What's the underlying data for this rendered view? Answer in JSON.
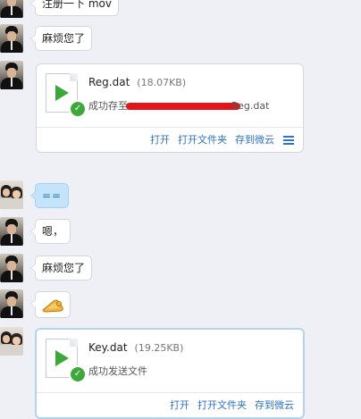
{
  "messages": [
    {
      "text": "注册一下 mov"
    },
    {
      "text": "麻烦您了"
    },
    {
      "text": "=="
    },
    {
      "text": "嗯，"
    },
    {
      "text": "麻烦您了"
    }
  ],
  "emoji": {
    "icon": "bow-emoji"
  },
  "files": [
    {
      "name": "Reg.dat",
      "size": "(18.07KB)",
      "status_prefix": "成功存至",
      "status_suffix": "Reg.dat",
      "actions": {
        "open": "打开",
        "open_folder": "打开文件夹",
        "save_cloud": "存到微云"
      }
    },
    {
      "name": "Key.dat",
      "size": "(19.25KB)",
      "status": "成功发送文件",
      "actions": {
        "open": "打开",
        "open_folder": "打开文件夹",
        "save_cloud": "存到微云"
      }
    }
  ],
  "colors": {
    "background": "#eef0f5",
    "link": "#2d72c6",
    "success": "#3ea83a",
    "redaction": "#e4151a"
  }
}
